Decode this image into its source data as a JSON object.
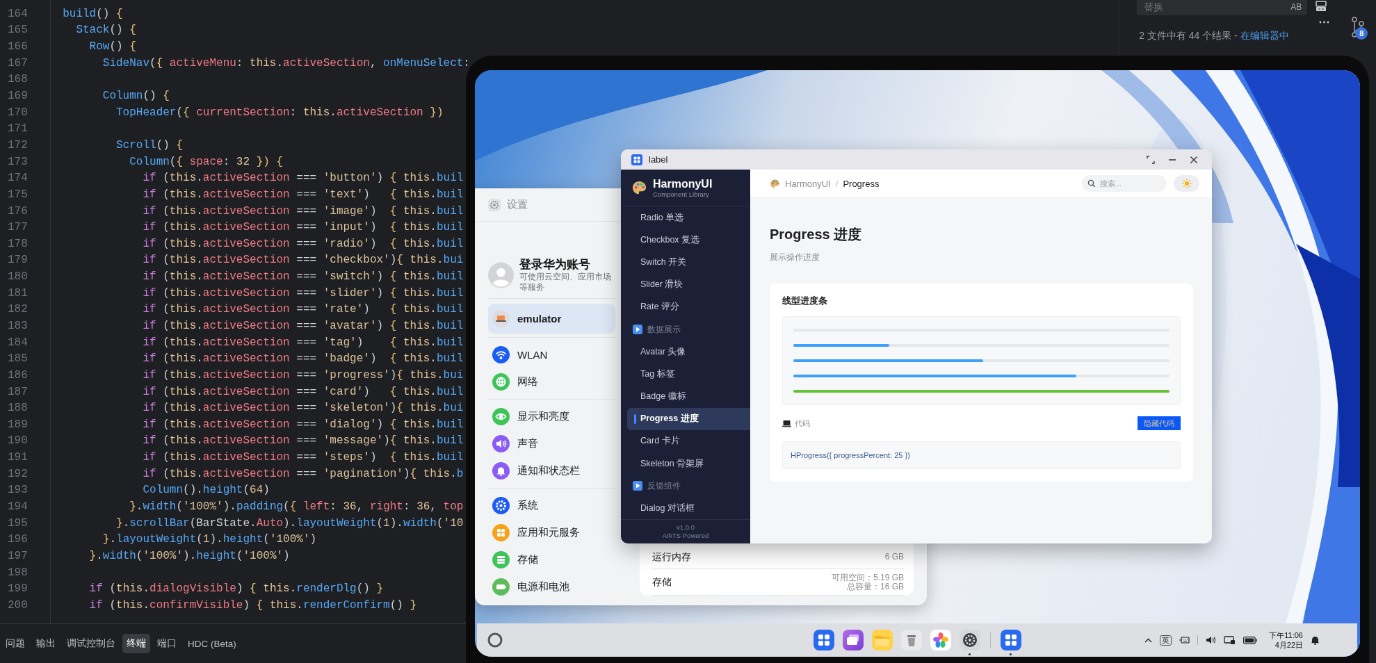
{
  "editor": {
    "lines": [
      {
        "number": "164",
        "code": [
          {
            "kind": "function",
            "text": "  build"
          },
          {
            "kind": "punct",
            "text": "() "
          },
          {
            "kind": "brace",
            "text": "{"
          }
        ]
      },
      {
        "number": "165",
        "code": [
          {
            "kind": "function",
            "text": "    Stack"
          },
          {
            "kind": "punct",
            "text": "() "
          },
          {
            "kind": "brace",
            "text": "{"
          }
        ]
      },
      {
        "number": "166",
        "code": [
          {
            "kind": "function",
            "text": "      Row"
          },
          {
            "kind": "punct",
            "text": "() "
          },
          {
            "kind": "brace",
            "text": "{"
          }
        ]
      },
      {
        "number": "167",
        "code": [
          {
            "kind": "function",
            "text": "        SideNav"
          },
          {
            "kind": "punct",
            "text": "("
          },
          {
            "kind": "brace",
            "text": "{ "
          },
          {
            "kind": "property",
            "text": "activeMenu"
          },
          {
            "kind": "punct",
            "text": ": "
          },
          {
            "kind": "self",
            "text": "this"
          },
          {
            "kind": "punct",
            "text": "."
          },
          {
            "kind": "property",
            "text": "activeSection"
          },
          {
            "kind": "punct",
            "text": ", "
          },
          {
            "kind": "function",
            "text": "onMenuSelect"
          },
          {
            "kind": "punct",
            "text": ":"
          }
        ]
      },
      {
        "number": "168"
      },
      {
        "number": "169",
        "code": [
          {
            "kind": "function",
            "text": "        Column"
          },
          {
            "kind": "punct",
            "text": "() "
          },
          {
            "kind": "brace",
            "text": "{"
          }
        ]
      },
      {
        "number": "170",
        "code": [
          {
            "kind": "function",
            "text": "          TopHeader"
          },
          {
            "kind": "punct",
            "text": "("
          },
          {
            "kind": "brace",
            "text": "{ "
          },
          {
            "kind": "property",
            "text": "currentSection"
          },
          {
            "kind": "punct",
            "text": ": "
          },
          {
            "kind": "self",
            "text": "this"
          },
          {
            "kind": "punct",
            "text": "."
          },
          {
            "kind": "property",
            "text": "activeSection"
          },
          {
            "kind": "brace",
            "text": " })"
          }
        ]
      },
      {
        "number": "171"
      },
      {
        "number": "172",
        "code": [
          {
            "kind": "function",
            "text": "          Scroll"
          },
          {
            "kind": "punct",
            "text": "() "
          },
          {
            "kind": "brace",
            "text": "{"
          }
        ]
      },
      {
        "number": "173",
        "code": [
          {
            "kind": "function",
            "text": "            Column"
          },
          {
            "kind": "punct",
            "text": "("
          },
          {
            "kind": "brace",
            "text": "{ "
          },
          {
            "kind": "property",
            "text": "space"
          },
          {
            "kind": "punct",
            "text": ": "
          },
          {
            "kind": "number",
            "text": "32"
          },
          {
            "kind": "brace",
            "text": " }) {"
          }
        ]
      },
      {
        "number": "174",
        "code": [
          {
            "kind": "keyword",
            "text": "              if "
          },
          {
            "kind": "punct",
            "text": "("
          },
          {
            "kind": "self",
            "text": "this"
          },
          {
            "kind": "punct",
            "text": "."
          },
          {
            "kind": "property",
            "text": "activeSection"
          },
          {
            "kind": "punct",
            "text": " === "
          },
          {
            "kind": "string",
            "text": "'button'"
          },
          {
            "kind": "punct",
            "text": ") "
          },
          {
            "kind": "brace",
            "text": "{ "
          },
          {
            "kind": "self",
            "text": "this"
          },
          {
            "kind": "punct",
            "text": "."
          },
          {
            "kind": "function",
            "text": "buil"
          }
        ]
      },
      {
        "number": "175",
        "code": [
          {
            "kind": "keyword",
            "text": "              if "
          },
          {
            "kind": "punct",
            "text": "("
          },
          {
            "kind": "self",
            "text": "this"
          },
          {
            "kind": "punct",
            "text": "."
          },
          {
            "kind": "property",
            "text": "activeSection"
          },
          {
            "kind": "punct",
            "text": " === "
          },
          {
            "kind": "string",
            "text": "'text'"
          },
          {
            "kind": "punct",
            "text": ")   "
          },
          {
            "kind": "brace",
            "text": "{ "
          },
          {
            "kind": "self",
            "text": "this"
          },
          {
            "kind": "punct",
            "text": "."
          },
          {
            "kind": "function",
            "text": "buil"
          }
        ]
      },
      {
        "number": "176",
        "code": [
          {
            "kind": "keyword",
            "text": "              if "
          },
          {
            "kind": "punct",
            "text": "("
          },
          {
            "kind": "self",
            "text": "this"
          },
          {
            "kind": "punct",
            "text": "."
          },
          {
            "kind": "property",
            "text": "activeSection"
          },
          {
            "kind": "punct",
            "text": " === "
          },
          {
            "kind": "string",
            "text": "'image'"
          },
          {
            "kind": "punct",
            "text": ")  "
          },
          {
            "kind": "brace",
            "text": "{ "
          },
          {
            "kind": "self",
            "text": "this"
          },
          {
            "kind": "punct",
            "text": "."
          },
          {
            "kind": "function",
            "text": "buil"
          }
        ]
      },
      {
        "number": "177",
        "code": [
          {
            "kind": "keyword",
            "text": "              if "
          },
          {
            "kind": "punct",
            "text": "("
          },
          {
            "kind": "self",
            "text": "this"
          },
          {
            "kind": "punct",
            "text": "."
          },
          {
            "kind": "property",
            "text": "activeSection"
          },
          {
            "kind": "punct",
            "text": " === "
          },
          {
            "kind": "string",
            "text": "'input'"
          },
          {
            "kind": "punct",
            "text": ")  "
          },
          {
            "kind": "brace",
            "text": "{ "
          },
          {
            "kind": "self",
            "text": "this"
          },
          {
            "kind": "punct",
            "text": "."
          },
          {
            "kind": "function",
            "text": "buil"
          }
        ]
      },
      {
        "number": "178",
        "code": [
          {
            "kind": "keyword",
            "text": "              if "
          },
          {
            "kind": "punct",
            "text": "("
          },
          {
            "kind": "self",
            "text": "this"
          },
          {
            "kind": "punct",
            "text": "."
          },
          {
            "kind": "property",
            "text": "activeSection"
          },
          {
            "kind": "punct",
            "text": " === "
          },
          {
            "kind": "string",
            "text": "'radio'"
          },
          {
            "kind": "punct",
            "text": ")  "
          },
          {
            "kind": "brace",
            "text": "{ "
          },
          {
            "kind": "self",
            "text": "this"
          },
          {
            "kind": "punct",
            "text": "."
          },
          {
            "kind": "function",
            "text": "buil"
          }
        ]
      },
      {
        "number": "179",
        "code": [
          {
            "kind": "keyword",
            "text": "              if "
          },
          {
            "kind": "punct",
            "text": "("
          },
          {
            "kind": "self",
            "text": "this"
          },
          {
            "kind": "punct",
            "text": "."
          },
          {
            "kind": "property",
            "text": "activeSection"
          },
          {
            "kind": "punct",
            "text": " === "
          },
          {
            "kind": "string",
            "text": "'checkbox'"
          },
          {
            "kind": "punct",
            "text": ")"
          },
          {
            "kind": "brace",
            "text": "{ "
          },
          {
            "kind": "self",
            "text": "this"
          },
          {
            "kind": "punct",
            "text": "."
          },
          {
            "kind": "function",
            "text": "bui"
          }
        ]
      },
      {
        "number": "180",
        "code": [
          {
            "kind": "keyword",
            "text": "              if "
          },
          {
            "kind": "punct",
            "text": "("
          },
          {
            "kind": "self",
            "text": "this"
          },
          {
            "kind": "punct",
            "text": "."
          },
          {
            "kind": "property",
            "text": "activeSection"
          },
          {
            "kind": "punct",
            "text": " === "
          },
          {
            "kind": "string",
            "text": "'switch'"
          },
          {
            "kind": "punct",
            "text": ") "
          },
          {
            "kind": "brace",
            "text": "{ "
          },
          {
            "kind": "self",
            "text": "this"
          },
          {
            "kind": "punct",
            "text": "."
          },
          {
            "kind": "function",
            "text": "buil"
          }
        ]
      },
      {
        "number": "181",
        "code": [
          {
            "kind": "keyword",
            "text": "              if "
          },
          {
            "kind": "punct",
            "text": "("
          },
          {
            "kind": "self",
            "text": "this"
          },
          {
            "kind": "punct",
            "text": "."
          },
          {
            "kind": "property",
            "text": "activeSection"
          },
          {
            "kind": "punct",
            "text": " === "
          },
          {
            "kind": "string",
            "text": "'slider'"
          },
          {
            "kind": "punct",
            "text": ") "
          },
          {
            "kind": "brace",
            "text": "{ "
          },
          {
            "kind": "self",
            "text": "this"
          },
          {
            "kind": "punct",
            "text": "."
          },
          {
            "kind": "function",
            "text": "buil"
          }
        ]
      },
      {
        "number": "182",
        "code": [
          {
            "kind": "keyword",
            "text": "              if "
          },
          {
            "kind": "punct",
            "text": "("
          },
          {
            "kind": "self",
            "text": "this"
          },
          {
            "kind": "punct",
            "text": "."
          },
          {
            "kind": "property",
            "text": "activeSection"
          },
          {
            "kind": "punct",
            "text": " === "
          },
          {
            "kind": "string",
            "text": "'rate'"
          },
          {
            "kind": "punct",
            "text": ")   "
          },
          {
            "kind": "brace",
            "text": "{ "
          },
          {
            "kind": "self",
            "text": "this"
          },
          {
            "kind": "punct",
            "text": "."
          },
          {
            "kind": "function",
            "text": "buil"
          }
        ]
      },
      {
        "number": "183",
        "code": [
          {
            "kind": "keyword",
            "text": "              if "
          },
          {
            "kind": "punct",
            "text": "("
          },
          {
            "kind": "self",
            "text": "this"
          },
          {
            "kind": "punct",
            "text": "."
          },
          {
            "kind": "property",
            "text": "activeSection"
          },
          {
            "kind": "punct",
            "text": " === "
          },
          {
            "kind": "string",
            "text": "'avatar'"
          },
          {
            "kind": "punct",
            "text": ") "
          },
          {
            "kind": "brace",
            "text": "{ "
          },
          {
            "kind": "self",
            "text": "this"
          },
          {
            "kind": "punct",
            "text": "."
          },
          {
            "kind": "function",
            "text": "buil"
          }
        ]
      },
      {
        "number": "184",
        "code": [
          {
            "kind": "keyword",
            "text": "              if "
          },
          {
            "kind": "punct",
            "text": "("
          },
          {
            "kind": "self",
            "text": "this"
          },
          {
            "kind": "punct",
            "text": "."
          },
          {
            "kind": "property",
            "text": "activeSection"
          },
          {
            "kind": "punct",
            "text": " === "
          },
          {
            "kind": "string",
            "text": "'tag'"
          },
          {
            "kind": "punct",
            "text": ")    "
          },
          {
            "kind": "brace",
            "text": "{ "
          },
          {
            "kind": "self",
            "text": "this"
          },
          {
            "kind": "punct",
            "text": "."
          },
          {
            "kind": "function",
            "text": "buil"
          }
        ]
      },
      {
        "number": "185",
        "code": [
          {
            "kind": "keyword",
            "text": "              if "
          },
          {
            "kind": "punct",
            "text": "("
          },
          {
            "kind": "self",
            "text": "this"
          },
          {
            "kind": "punct",
            "text": "."
          },
          {
            "kind": "property",
            "text": "activeSection"
          },
          {
            "kind": "punct",
            "text": " === "
          },
          {
            "kind": "string",
            "text": "'badge'"
          },
          {
            "kind": "punct",
            "text": ")  "
          },
          {
            "kind": "brace",
            "text": "{ "
          },
          {
            "kind": "self",
            "text": "this"
          },
          {
            "kind": "punct",
            "text": "."
          },
          {
            "kind": "function",
            "text": "buil"
          }
        ]
      },
      {
        "number": "186",
        "code": [
          {
            "kind": "keyword",
            "text": "              if "
          },
          {
            "kind": "punct",
            "text": "("
          },
          {
            "kind": "self",
            "text": "this"
          },
          {
            "kind": "punct",
            "text": "."
          },
          {
            "kind": "property",
            "text": "activeSection"
          },
          {
            "kind": "punct",
            "text": " === "
          },
          {
            "kind": "string",
            "text": "'progress'"
          },
          {
            "kind": "punct",
            "text": ")"
          },
          {
            "kind": "brace",
            "text": "{ "
          },
          {
            "kind": "self",
            "text": "this"
          },
          {
            "kind": "punct",
            "text": "."
          },
          {
            "kind": "function",
            "text": "bui"
          }
        ]
      },
      {
        "number": "187",
        "code": [
          {
            "kind": "keyword",
            "text": "              if "
          },
          {
            "kind": "punct",
            "text": "("
          },
          {
            "kind": "self",
            "text": "this"
          },
          {
            "kind": "punct",
            "text": "."
          },
          {
            "kind": "property",
            "text": "activeSection"
          },
          {
            "kind": "punct",
            "text": " === "
          },
          {
            "kind": "string",
            "text": "'card'"
          },
          {
            "kind": "punct",
            "text": ")   "
          },
          {
            "kind": "brace",
            "text": "{ "
          },
          {
            "kind": "self",
            "text": "this"
          },
          {
            "kind": "punct",
            "text": "."
          },
          {
            "kind": "function",
            "text": "buil"
          }
        ]
      },
      {
        "number": "188",
        "code": [
          {
            "kind": "keyword",
            "text": "              if "
          },
          {
            "kind": "punct",
            "text": "("
          },
          {
            "kind": "self",
            "text": "this"
          },
          {
            "kind": "punct",
            "text": "."
          },
          {
            "kind": "property",
            "text": "activeSection"
          },
          {
            "kind": "punct",
            "text": " === "
          },
          {
            "kind": "string",
            "text": "'skeleton'"
          },
          {
            "kind": "punct",
            "text": ")"
          },
          {
            "kind": "brace",
            "text": "{ "
          },
          {
            "kind": "self",
            "text": "this"
          },
          {
            "kind": "punct",
            "text": "."
          },
          {
            "kind": "function",
            "text": "bui"
          }
        ]
      },
      {
        "number": "189",
        "code": [
          {
            "kind": "keyword",
            "text": "              if "
          },
          {
            "kind": "punct",
            "text": "("
          },
          {
            "kind": "self",
            "text": "this"
          },
          {
            "kind": "punct",
            "text": "."
          },
          {
            "kind": "property",
            "text": "activeSection"
          },
          {
            "kind": "punct",
            "text": " === "
          },
          {
            "kind": "string",
            "text": "'dialog'"
          },
          {
            "kind": "punct",
            "text": ") "
          },
          {
            "kind": "brace",
            "text": "{ "
          },
          {
            "kind": "self",
            "text": "this"
          },
          {
            "kind": "punct",
            "text": "."
          },
          {
            "kind": "function",
            "text": "buil"
          }
        ]
      },
      {
        "number": "190",
        "code": [
          {
            "kind": "keyword",
            "text": "              if "
          },
          {
            "kind": "punct",
            "text": "("
          },
          {
            "kind": "self",
            "text": "this"
          },
          {
            "kind": "punct",
            "text": "."
          },
          {
            "kind": "property",
            "text": "activeSection"
          },
          {
            "kind": "punct",
            "text": " === "
          },
          {
            "kind": "string",
            "text": "'message'"
          },
          {
            "kind": "punct",
            "text": ")"
          },
          {
            "kind": "brace",
            "text": "{ "
          },
          {
            "kind": "self",
            "text": "this"
          },
          {
            "kind": "punct",
            "text": "."
          },
          {
            "kind": "function",
            "text": "buil"
          }
        ]
      },
      {
        "number": "191",
        "code": [
          {
            "kind": "keyword",
            "text": "              if "
          },
          {
            "kind": "punct",
            "text": "("
          },
          {
            "kind": "self",
            "text": "this"
          },
          {
            "kind": "punct",
            "text": "."
          },
          {
            "kind": "property",
            "text": "activeSection"
          },
          {
            "kind": "punct",
            "text": " === "
          },
          {
            "kind": "string",
            "text": "'steps'"
          },
          {
            "kind": "punct",
            "text": ")  "
          },
          {
            "kind": "brace",
            "text": "{ "
          },
          {
            "kind": "self",
            "text": "this"
          },
          {
            "kind": "punct",
            "text": "."
          },
          {
            "kind": "function",
            "text": "buil"
          }
        ]
      },
      {
        "number": "192",
        "code": [
          {
            "kind": "keyword",
            "text": "              if "
          },
          {
            "kind": "punct",
            "text": "("
          },
          {
            "kind": "self",
            "text": "this"
          },
          {
            "kind": "punct",
            "text": "."
          },
          {
            "kind": "property",
            "text": "activeSection"
          },
          {
            "kind": "punct",
            "text": " === "
          },
          {
            "kind": "string",
            "text": "'pagination'"
          },
          {
            "kind": "punct",
            "text": ")"
          },
          {
            "kind": "brace",
            "text": "{ "
          },
          {
            "kind": "self",
            "text": "this"
          },
          {
            "kind": "punct",
            "text": "."
          },
          {
            "kind": "function",
            "text": "b"
          }
        ]
      },
      {
        "number": "193",
        "code": [
          {
            "kind": "function",
            "text": "              Column"
          },
          {
            "kind": "punct",
            "text": "()."
          },
          {
            "kind": "function",
            "text": "height"
          },
          {
            "kind": "punct",
            "text": "("
          },
          {
            "kind": "number",
            "text": "64"
          },
          {
            "kind": "punct",
            "text": ")"
          }
        ]
      },
      {
        "number": "194",
        "code": [
          {
            "kind": "brace",
            "text": "            }"
          },
          {
            "kind": "punct",
            "text": "."
          },
          {
            "kind": "function",
            "text": "width"
          },
          {
            "kind": "punct",
            "text": "("
          },
          {
            "kind": "string",
            "text": "'100%'"
          },
          {
            "kind": "punct",
            "text": ")."
          },
          {
            "kind": "function",
            "text": "padding"
          },
          {
            "kind": "punct",
            "text": "("
          },
          {
            "kind": "brace",
            "text": "{ "
          },
          {
            "kind": "property",
            "text": "left"
          },
          {
            "kind": "punct",
            "text": ": "
          },
          {
            "kind": "number",
            "text": "36"
          },
          {
            "kind": "punct",
            "text": ", "
          },
          {
            "kind": "property",
            "text": "right"
          },
          {
            "kind": "punct",
            "text": ": "
          },
          {
            "kind": "number",
            "text": "36"
          },
          {
            "kind": "punct",
            "text": ", "
          },
          {
            "kind": "property",
            "text": "top"
          }
        ]
      },
      {
        "number": "195",
        "code": [
          {
            "kind": "brace",
            "text": "          }"
          },
          {
            "kind": "punct",
            "text": "."
          },
          {
            "kind": "function",
            "text": "scrollBar"
          },
          {
            "kind": "punct",
            "text": "(BarState."
          },
          {
            "kind": "property",
            "text": "Auto"
          },
          {
            "kind": "punct",
            "text": ")."
          },
          {
            "kind": "function",
            "text": "layoutWeight"
          },
          {
            "kind": "punct",
            "text": "("
          },
          {
            "kind": "number",
            "text": "1"
          },
          {
            "kind": "punct",
            "text": ")."
          },
          {
            "kind": "function",
            "text": "width"
          },
          {
            "kind": "punct",
            "text": "("
          },
          {
            "kind": "string",
            "text": "'10"
          }
        ]
      },
      {
        "number": "196",
        "code": [
          {
            "kind": "brace",
            "text": "        }"
          },
          {
            "kind": "punct",
            "text": "."
          },
          {
            "kind": "function",
            "text": "layoutWeight"
          },
          {
            "kind": "punct",
            "text": "("
          },
          {
            "kind": "number",
            "text": "1"
          },
          {
            "kind": "punct",
            "text": ")."
          },
          {
            "kind": "function",
            "text": "height"
          },
          {
            "kind": "punct",
            "text": "("
          },
          {
            "kind": "string",
            "text": "'100%'"
          },
          {
            "kind": "punct",
            "text": ")"
          }
        ]
      },
      {
        "number": "197",
        "code": [
          {
            "kind": "brace",
            "text": "      }"
          },
          {
            "kind": "punct",
            "text": "."
          },
          {
            "kind": "function",
            "text": "width"
          },
          {
            "kind": "punct",
            "text": "("
          },
          {
            "kind": "string",
            "text": "'100%'"
          },
          {
            "kind": "punct",
            "text": ")."
          },
          {
            "kind": "function",
            "text": "height"
          },
          {
            "kind": "punct",
            "text": "("
          },
          {
            "kind": "string",
            "text": "'100%'"
          },
          {
            "kind": "punct",
            "text": ")"
          }
        ]
      },
      {
        "number": "198"
      },
      {
        "number": "199",
        "code": [
          {
            "kind": "keyword",
            "text": "      if "
          },
          {
            "kind": "punct",
            "text": "("
          },
          {
            "kind": "self",
            "text": "this"
          },
          {
            "kind": "punct",
            "text": "."
          },
          {
            "kind": "property",
            "text": "dialogVisible"
          },
          {
            "kind": "punct",
            "text": ") "
          },
          {
            "kind": "brace",
            "text": "{ "
          },
          {
            "kind": "self",
            "text": "this"
          },
          {
            "kind": "punct",
            "text": "."
          },
          {
            "kind": "function",
            "text": "renderDlg"
          },
          {
            "kind": "punct",
            "text": "() "
          },
          {
            "kind": "brace",
            "text": "}"
          }
        ]
      },
      {
        "number": "200",
        "code": [
          {
            "kind": "keyword",
            "text": "      if "
          },
          {
            "kind": "punct",
            "text": "("
          },
          {
            "kind": "self",
            "text": "this"
          },
          {
            "kind": "punct",
            "text": "."
          },
          {
            "kind": "property",
            "text": "confirmVisible"
          },
          {
            "kind": "punct",
            "text": ") "
          },
          {
            "kind": "brace",
            "text": "{ "
          },
          {
            "kind": "self",
            "text": "this"
          },
          {
            "kind": "punct",
            "text": "."
          },
          {
            "kind": "function",
            "text": "renderConfirm"
          },
          {
            "kind": "punct",
            "text": "() "
          },
          {
            "kind": "brace",
            "text": "}"
          }
        ]
      }
    ],
    "panel_tabs": [
      {
        "label": "问题",
        "selected": false
      },
      {
        "label": "输出",
        "selected": false
      },
      {
        "label": "调试控制台",
        "selected": false
      },
      {
        "label": "终端",
        "selected": true
      },
      {
        "label": "端口",
        "selected": false
      },
      {
        "label": "HDC (Beta)",
        "selected": false
      }
    ]
  },
  "search_panel": {
    "replace_placeholder": "替换",
    "preserve_case": "AB",
    "result_summary": "2 文件中有 44 个结果 - ",
    "result_link": "在编辑器中",
    "badge": "8"
  },
  "tablet": {
    "settings": {
      "title": "设置",
      "account": {
        "name": "登录华为账号",
        "subtitle": "可使用云空间、应用市场等服务"
      },
      "groups": [
        {
          "items": [
            {
              "kind": "device",
              "label": "emulator",
              "selected": true
            }
          ]
        },
        {
          "items": [
            {
              "kind": "wifi",
              "label": "WLAN",
              "color": "#1a5cf5",
              "selected": false
            },
            {
              "kind": "globe",
              "label": "网络",
              "color": "#3ec45a",
              "selected": false
            }
          ]
        },
        {
          "items": [
            {
              "kind": "eye",
              "label": "显示和亮度",
              "color": "#3ec45a",
              "selected": false
            },
            {
              "kind": "speaker",
              "label": "声音",
              "color": "#8a5cf5",
              "selected": false
            },
            {
              "kind": "bell",
              "label": "通知和状态栏",
              "color": "#8a5cf5",
              "selected": false
            }
          ]
        },
        {
          "items": [
            {
              "kind": "gear",
              "label": "系统",
              "color": "#1a5cf5",
              "selected": false
            },
            {
              "kind": "grid",
              "label": "应用和元服务",
              "color": "#f7a21b",
              "selected": false
            },
            {
              "kind": "storage",
              "label": "存储",
              "color": "#3ec45a",
              "selected": false
            },
            {
              "kind": "battery",
              "label": "电源和电池",
              "color": "#5dbd5b",
              "selected": false
            }
          ]
        }
      ],
      "info_rows": [
        {
          "label": "运行内存",
          "values": [
            "6 GB"
          ]
        },
        {
          "label": "存储",
          "values": [
            "可用空间：5.19 GB",
            "总容量：16 GB"
          ]
        }
      ]
    },
    "app": {
      "title": "label",
      "brand": "HarmonyUI",
      "brand_sub": "Component Library",
      "nav": [
        {
          "kind": "item",
          "label": "Radio 单选",
          "selected": false
        },
        {
          "kind": "item",
          "label": "Checkbox 复选",
          "selected": false
        },
        {
          "kind": "item",
          "label": "Switch 开关",
          "selected": false
        },
        {
          "kind": "item",
          "label": "Slider 滑块",
          "selected": false
        },
        {
          "kind": "item",
          "label": "Rate 评分",
          "selected": false
        },
        {
          "kind": "section",
          "label": "数据展示"
        },
        {
          "kind": "item",
          "label": "Avatar 头像",
          "selected": false
        },
        {
          "kind": "item",
          "label": "Tag 标签",
          "selected": false
        },
        {
          "kind": "item",
          "label": "Badge 徽标",
          "selected": false
        },
        {
          "kind": "item",
          "label": "Progress 进度",
          "selected": true
        },
        {
          "kind": "item",
          "label": "Card 卡片",
          "selected": false
        },
        {
          "kind": "item",
          "label": "Skeleton 骨架屏",
          "selected": false
        },
        {
          "kind": "section",
          "label": "反馈组件"
        },
        {
          "kind": "item",
          "label": "Dialog 对话框",
          "selected": false
        }
      ],
      "version": "v1.0.0",
      "powered": "ArkTS Powered",
      "breadcrumb": [
        "HarmonyUI",
        "Progress"
      ],
      "breadcrumb_separator": "/",
      "search_placeholder": "搜索...",
      "page_title": "Progress 进度",
      "page_subtitle": "展示操作进度",
      "card_title": "线型进度条",
      "bars": [
        {
          "level": 0
        },
        {
          "level": 0.256,
          "color": "#409eff"
        },
        {
          "level": 0.504,
          "color": "#409eff"
        },
        {
          "level": 0.752,
          "color": "#409eff"
        },
        {
          "level": 1,
          "color": "#67c23a"
        }
      ],
      "code_label": "代码",
      "code_toggle": "隐藏代码",
      "code": "HProgress({ progressPercent: 25 })"
    },
    "taskbar": {
      "dock": [
        {
          "kind": "launcher",
          "running": false
        },
        {
          "kind": "multitask",
          "running": false
        },
        {
          "kind": "files",
          "running": false
        },
        {
          "kind": "trash",
          "running": false
        },
        {
          "kind": "gallery",
          "running": false
        },
        {
          "kind": "settings",
          "running": true
        }
      ],
      "dock_open": [
        {
          "kind": "launcher",
          "running": true
        }
      ],
      "input_method": "英",
      "time": "下午11:06",
      "date": "4月22日"
    }
  }
}
